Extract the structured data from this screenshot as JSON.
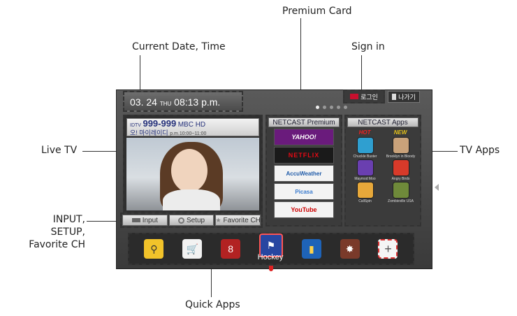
{
  "callouts": {
    "premium_card": "Premium Card",
    "date_time": "Current Date, Time",
    "sign_in": "Sign in",
    "live_tv": "Live TV",
    "tv_apps": "TV Apps",
    "input_setup_fav": "INPUT,\nSETUP,\nFavorite CH",
    "quick_apps": "Quick Apps"
  },
  "top_bar": {
    "date": "03. 24",
    "day": "THU",
    "time": "08:13 p.m.",
    "login_label": "로그인",
    "exit_label": "나가기"
  },
  "live_tv": {
    "channel_prefix": "IDTV",
    "channel_number": "999-999",
    "channel_name": "MBC HD",
    "program_title": "오! 마이레이디",
    "program_time": "p.m.10:00~11:00"
  },
  "controls": {
    "input_label": "Input",
    "setup_label": "Setup",
    "favorite_label": "Favorite CH"
  },
  "premium": {
    "title": "NETCAST Premium",
    "cards": [
      "YAHOO!",
      "NETFLIX",
      "AccuWeather",
      "Picasa",
      "YouTube"
    ]
  },
  "apps": {
    "title": "NETCAST Apps",
    "hot_label": "HOT",
    "new_label": "NEW",
    "items": [
      "Chuckle Buster",
      "Brooklyn in Bloody",
      "Maymod Moo",
      "Angry Birds",
      "CallSpin",
      "Zombieville USA"
    ]
  },
  "quick_apps": {
    "hockey_label": "Hockey",
    "add_label": "+"
  },
  "colors": {
    "screen_bg": "#4a4a4a",
    "hot": "#ee2222",
    "new": "#e5c21a",
    "accent_red": "#c8102e"
  }
}
